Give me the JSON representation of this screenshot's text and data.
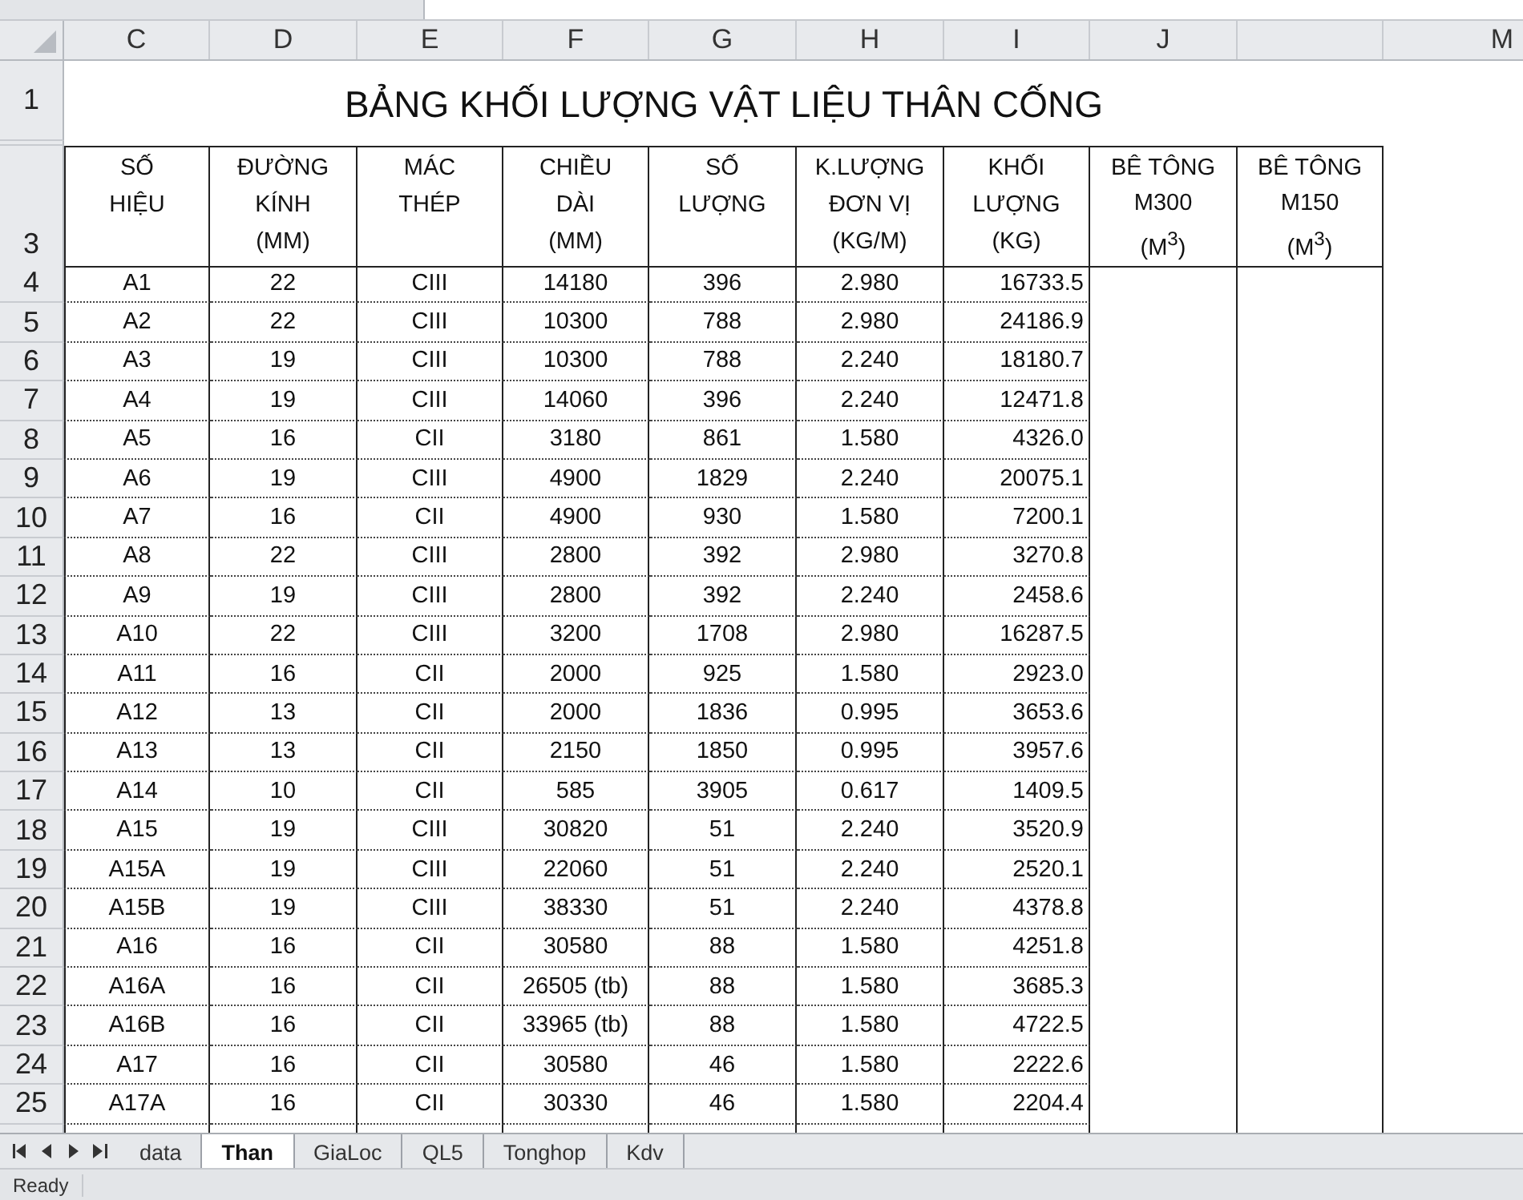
{
  "column_headers": [
    "C",
    "D",
    "E",
    "F",
    "G",
    "H",
    "I",
    "J",
    "M"
  ],
  "title": {
    "row": "1",
    "text": "BẢNG KHỐI LƯỢNG VẬT LIỆU THÂN CỐNG"
  },
  "header_row": {
    "row": "3",
    "cells": [
      "SỐ\nHIỆU",
      "ĐƯỜNG\nKÍNH\n(MM)",
      "MÁC\nTHÉP",
      "CHIỀU\nDÀI\n(MM)",
      "SỐ\nLƯỢNG",
      "K.LƯỢNG\nĐƠN VỊ\n(KG/M)",
      "KHỐI\nLƯỢNG\n(KG)",
      "BÊ TÔNG\nM300\n(M$^{3}$)",
      "BÊ TÔNG\nM150\n(M$^{3}$)"
    ]
  },
  "rows": [
    {
      "row": "4",
      "cells": [
        "A1",
        "22",
        "CIII",
        "14180",
        "396",
        "2.980",
        "16733.5"
      ]
    },
    {
      "row": "5",
      "cells": [
        "A2",
        "22",
        "CIII",
        "10300",
        "788",
        "2.980",
        "24186.9"
      ]
    },
    {
      "row": "6",
      "cells": [
        "A3",
        "19",
        "CIII",
        "10300",
        "788",
        "2.240",
        "18180.7"
      ]
    },
    {
      "row": "7",
      "cells": [
        "A4",
        "19",
        "CIII",
        "14060",
        "396",
        "2.240",
        "12471.8"
      ]
    },
    {
      "row": "8",
      "cells": [
        "A5",
        "16",
        "CII",
        "3180",
        "861",
        "1.580",
        "4326.0"
      ]
    },
    {
      "row": "9",
      "cells": [
        "A6",
        "19",
        "CIII",
        "4900",
        "1829",
        "2.240",
        "20075.1"
      ]
    },
    {
      "row": "10",
      "cells": [
        "A7",
        "16",
        "CII",
        "4900",
        "930",
        "1.580",
        "7200.1"
      ]
    },
    {
      "row": "11",
      "cells": [
        "A8",
        "22",
        "CIII",
        "2800",
        "392",
        "2.980",
        "3270.8"
      ]
    },
    {
      "row": "12",
      "cells": [
        "A9",
        "19",
        "CIII",
        "2800",
        "392",
        "2.240",
        "2458.6"
      ]
    },
    {
      "row": "13",
      "cells": [
        "A10",
        "22",
        "CIII",
        "3200",
        "1708",
        "2.980",
        "16287.5"
      ]
    },
    {
      "row": "14",
      "cells": [
        "A11",
        "16",
        "CII",
        "2000",
        "925",
        "1.580",
        "2923.0"
      ]
    },
    {
      "row": "15",
      "cells": [
        "A12",
        "13",
        "CII",
        "2000",
        "1836",
        "0.995",
        "3653.6"
      ]
    },
    {
      "row": "16",
      "cells": [
        "A13",
        "13",
        "CII",
        "2150",
        "1850",
        "0.995",
        "3957.6"
      ]
    },
    {
      "row": "17",
      "cells": [
        "A14",
        "10",
        "CII",
        "585",
        "3905",
        "0.617",
        "1409.5"
      ]
    },
    {
      "row": "18",
      "cells": [
        "A15",
        "19",
        "CIII",
        "30820",
        "51",
        "2.240",
        "3520.9"
      ]
    },
    {
      "row": "19",
      "cells": [
        "A15A",
        "19",
        "CIII",
        "22060",
        "51",
        "2.240",
        "2520.1"
      ]
    },
    {
      "row": "20",
      "cells": [
        "A15B",
        "19",
        "CIII",
        "38330",
        "51",
        "2.240",
        "4378.8"
      ]
    },
    {
      "row": "21",
      "cells": [
        "A16",
        "16",
        "CII",
        "30580",
        "88",
        "1.580",
        "4251.8"
      ]
    },
    {
      "row": "22",
      "cells": [
        "A16A",
        "16",
        "CII",
        "26505 (tb)",
        "88",
        "1.580",
        "3685.3"
      ]
    },
    {
      "row": "23",
      "cells": [
        "A16B",
        "16",
        "CII",
        "33965 (tb)",
        "88",
        "1.580",
        "4722.5"
      ]
    },
    {
      "row": "24",
      "cells": [
        "A17",
        "16",
        "CII",
        "30580",
        "46",
        "1.580",
        "2222.6"
      ]
    },
    {
      "row": "25",
      "cells": [
        "A17A",
        "16",
        "CII",
        "30330",
        "46",
        "1.580",
        "2204.4"
      ]
    }
  ],
  "sheet_tabs": [
    {
      "label": "data",
      "selected": false
    },
    {
      "label": "Than",
      "selected": true
    },
    {
      "label": "GiaLoc",
      "selected": false
    },
    {
      "label": "QL5",
      "selected": false
    },
    {
      "label": "Tonghop",
      "selected": false
    },
    {
      "label": "Kdv",
      "selected": false
    }
  ],
  "status_bar": {
    "text": "Ready"
  }
}
